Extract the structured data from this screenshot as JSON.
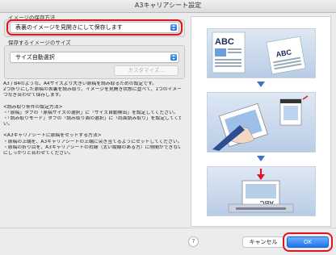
{
  "window": {
    "title": "A3キャリアシート設定"
  },
  "image_save_method": {
    "label": "イメージの保存方法",
    "selected": "表裏のイメージを見開きにして保存します"
  },
  "image_size": {
    "label": "保存するイメージのサイズ",
    "selected": "サイズ自動選択",
    "customize_button": "カスタマイズ..."
  },
  "description": {
    "lines_1": [
      "A3 / B4のような、A4サイズより大きい原稿を読み取るための設定です。",
      "2つ折りにした原稿の表裏を読み取り、イメージを見開き状態に並べて、1つのイメージに",
      "つなぎ合わせて保存します。"
    ],
    "lines_2": [
      "<読み取り条件の設定方法>",
      "・「原稿」タブの「原稿サイズの選択」に「サイズ自動検出」を設定してください。",
      "・「読み取りモード」タブの「読み取り面の選択」に「両面読み取り」を設定してくださ",
      "い。"
    ],
    "lines_3": [
      "<A3キャリアシートに原稿をセットする方法>",
      "・原稿の上端を、A3キャリアシートの上端に突き当てるようにセットしてください。",
      "・原稿の折り目を、A3キャリアシートの右縁（太い縦線のある方）に隙間ができないよう",
      "にしっかりと合わせてください。"
    ]
  },
  "illustration": {
    "panel1": {
      "text_a": "ABC",
      "text_b": "ABC"
    },
    "panel3": {
      "text": "ABC"
    }
  },
  "footer": {
    "help_label": "?",
    "cancel_button": "キャンセル",
    "ok_button": "OK"
  },
  "colors": {
    "accent": "#1e74ee",
    "highlight": "#e0141e",
    "arrow": "#3b73c8"
  }
}
